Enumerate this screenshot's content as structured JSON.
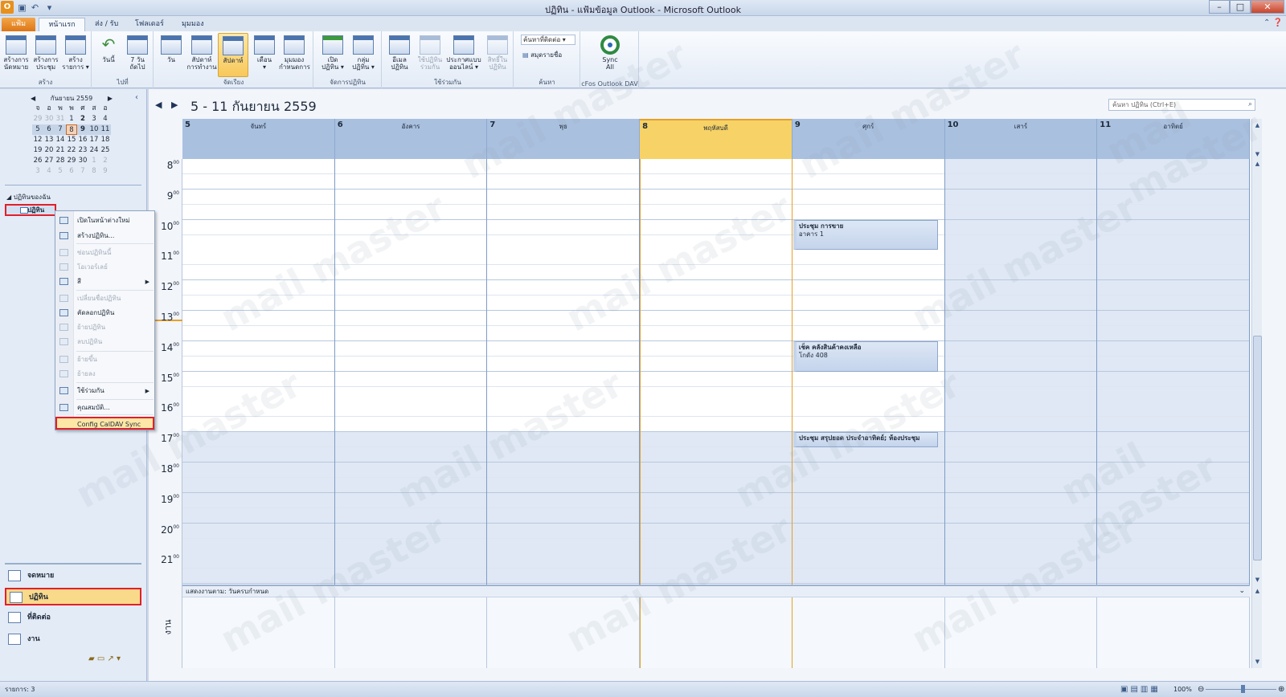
{
  "window": {
    "title": "ปฏิทิน - แฟ้มข้อมูล Outlook - Microsoft Outlook",
    "app_icon": "O",
    "minimize": "–",
    "maximize": "□",
    "close": "✕"
  },
  "tabs": {
    "file": "แฟ้ม",
    "home": "หน้าแรก",
    "send_receive": "ส่ง / รับ",
    "folder": "โฟลเดอร์",
    "view": "มุมมอง"
  },
  "ribbon": {
    "groups": {
      "new": "สร้าง",
      "goto": "ไปที่",
      "arrange": "จัดเรียง",
      "manage": "จัดการปฏิทิน",
      "share": "ใช้ร่วมกัน",
      "find": "ค้นหา",
      "cfos": "cFos Outlook DAV"
    },
    "buttons": {
      "new_appointment": "สร้างการ\nนัดหมาย",
      "new_meeting": "สร้างการ\nประชุม",
      "new_items": "สร้าง\nรายการ ▾",
      "today": "วันนี้",
      "next7": "7 วัน\nถัดไป",
      "day": "วัน",
      "work_week": "สัปดาห์\nการทำงาน",
      "week": "สัปดาห์",
      "month": "เดือน\n▾",
      "schedule": "มุมมอง\nกำหนดการ",
      "open_calendar": "เปิด\nปฏิทิน ▾",
      "calendar_groups": "กลุ่ม\nปฏิทิน ▾",
      "email_calendar": "อีเมล\nปฏิทิน",
      "share_calendar": "ใช้ปฏิทิน\nร่วมกัน",
      "publish_online": "ประกาศแบบ\nออนไลน์ ▾",
      "calendar_permissions": "สิทธิ์ใน\nปฏิทิน",
      "sync_all": "Sync\nAll"
    },
    "find_contact": "ค้นหาที่ติดต่อ ▾",
    "address_book": "สมุดรายชื่อ"
  },
  "mini_calendar": {
    "month_label": "กันยายน 2559",
    "weekday_headers": [
      "จ",
      "อ",
      "พ",
      "พ",
      "ศ",
      "ส",
      "อ"
    ],
    "weeks": [
      [
        "29",
        "30",
        "31",
        "1",
        "2",
        "3",
        "4"
      ],
      [
        "5",
        "6",
        "7",
        "8",
        "9",
        "10",
        "11"
      ],
      [
        "12",
        "13",
        "14",
        "15",
        "16",
        "17",
        "18"
      ],
      [
        "19",
        "20",
        "21",
        "22",
        "23",
        "24",
        "25"
      ],
      [
        "26",
        "27",
        "28",
        "29",
        "30",
        "1",
        "2"
      ],
      [
        "3",
        "4",
        "5",
        "6",
        "7",
        "8",
        "9"
      ]
    ]
  },
  "nav": {
    "my_calendars_header": "◢ ปฏิทินของฉัน",
    "calendar_item": "ปฏิทิน",
    "mail": "จดหมาย",
    "calendar": "ปฏิทิน",
    "contacts": "ที่ติดต่อ",
    "tasks": "งาน"
  },
  "context_menu": {
    "items": [
      {
        "label": "เปิดในหน้าต่างใหม่",
        "enabled": true
      },
      {
        "label": "สร้างปฏิทิน...",
        "enabled": true
      },
      {
        "label": "ซ่อนปฏิทินนี้",
        "enabled": false
      },
      {
        "label": "โอเวอร์เลย์",
        "enabled": false
      },
      {
        "label": "สี",
        "enabled": true,
        "submenu": true
      },
      {
        "label": "เปลี่ยนชื่อปฏิทิน",
        "enabled": false
      },
      {
        "label": "คัดลอกปฏิทิน",
        "enabled": true
      },
      {
        "label": "ย้ายปฏิทิน",
        "enabled": false
      },
      {
        "label": "ลบปฏิทิน",
        "enabled": false
      },
      {
        "label": "ย้ายขึ้น",
        "enabled": false
      },
      {
        "label": "ย้ายลง",
        "enabled": false
      },
      {
        "label": "ใช้ร่วมกัน",
        "enabled": true,
        "submenu": true
      },
      {
        "label": "คุณสมบัติ...",
        "enabled": true
      },
      {
        "label": "Config CalDAV Sync",
        "enabled": true
      }
    ]
  },
  "calendar": {
    "range_title": "5 - 11 กันยายน 2559",
    "search_placeholder": "ค้นหา ปฏิทิน (Ctrl+E)",
    "days": [
      {
        "num": "5",
        "name": "จันทร์"
      },
      {
        "num": "6",
        "name": "อังคาร"
      },
      {
        "num": "7",
        "name": "พุธ"
      },
      {
        "num": "8",
        "name": "พฤหัสบดี",
        "today": true
      },
      {
        "num": "9",
        "name": "ศุกร์"
      },
      {
        "num": "10",
        "name": "เสาร์"
      },
      {
        "num": "11",
        "name": "อาทิตย์"
      }
    ],
    "hours": [
      "8",
      "9",
      "10",
      "11",
      "12",
      "13",
      "14",
      "15",
      "16",
      "17",
      "18",
      "19",
      "20",
      "21"
    ],
    "hour_suffix": "00",
    "appointments": [
      {
        "day": "9",
        "start": "10:00",
        "end": "11:00",
        "subject": "ประชุม การขาย",
        "location": "อาคาร 1"
      },
      {
        "day": "9",
        "start": "14:00",
        "end": "15:00",
        "subject": "เช็ค คลังสินค้าคงเหลือ",
        "location": "โกดัง 408"
      },
      {
        "day": "9",
        "start": "17:00",
        "end": "17:30",
        "subject": "ประชุม สรุปยอด ประจำอาทิตย์; ห้องประชุม",
        "location": ""
      }
    ],
    "tasks_bar_label": "แสดงงานตาม: วันครบกำหนด",
    "tasks_label": "งาน"
  },
  "status": {
    "items": "รายการ: 3",
    "zoom": "100%"
  },
  "watermark": "mail master"
}
